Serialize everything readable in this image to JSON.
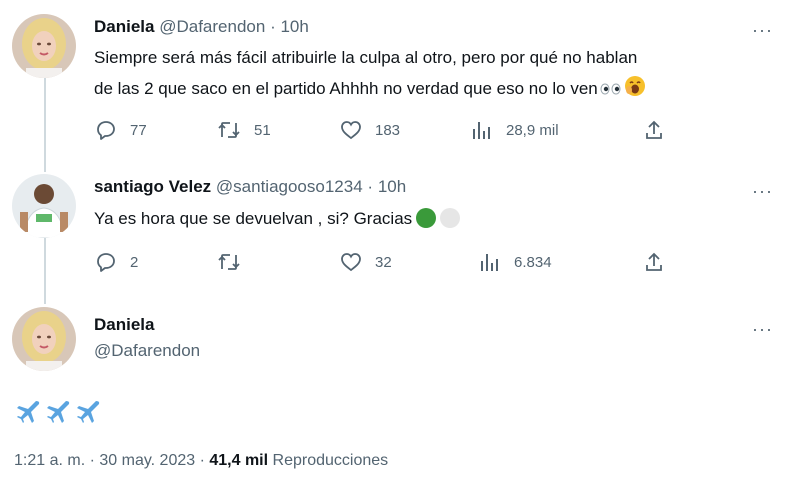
{
  "tweet1": {
    "name": "Daniela",
    "handle": "@Dafarendon",
    "dot": "·",
    "time": "10h",
    "line1": "Siempre será más fácil atribuirle la culpa al otro, pero por  qué no hablan",
    "line2": "de las 2 que saco en el partido  Ahhhh no verdad que eso no lo ven",
    "replies": "77",
    "retweets": "51",
    "likes": "183",
    "views": "28,9 mil"
  },
  "tweet2": {
    "name": "santiago Velez",
    "handle": "@santiagooso1234",
    "dot": "·",
    "time": "10h",
    "line1": "Ya es hora que se devuelvan , si? Gracias",
    "replies": "2",
    "retweets": "",
    "likes": "32",
    "views": "6.834"
  },
  "main_tweet": {
    "name": "Daniela",
    "handle": "@Dafarendon",
    "timestamp": "1:21 a. m. · 30 may. 2023 · ",
    "views_count": "41,4 mil",
    "views_label": " Reproducciones"
  },
  "more_label": "···",
  "icons": {
    "reply": "reply-icon",
    "retweet": "retweet-icon",
    "like": "heart-icon",
    "views": "views-icon",
    "share": "share-icon",
    "airplane": "airplane-emoji"
  },
  "colors": {
    "text": "#0f1419",
    "muted": "#536471",
    "green_circle": "#3a9a3a",
    "white_circle": "#e6e6e6",
    "airplane": "#5aa4e0",
    "thread_line": "#cfd9de"
  }
}
